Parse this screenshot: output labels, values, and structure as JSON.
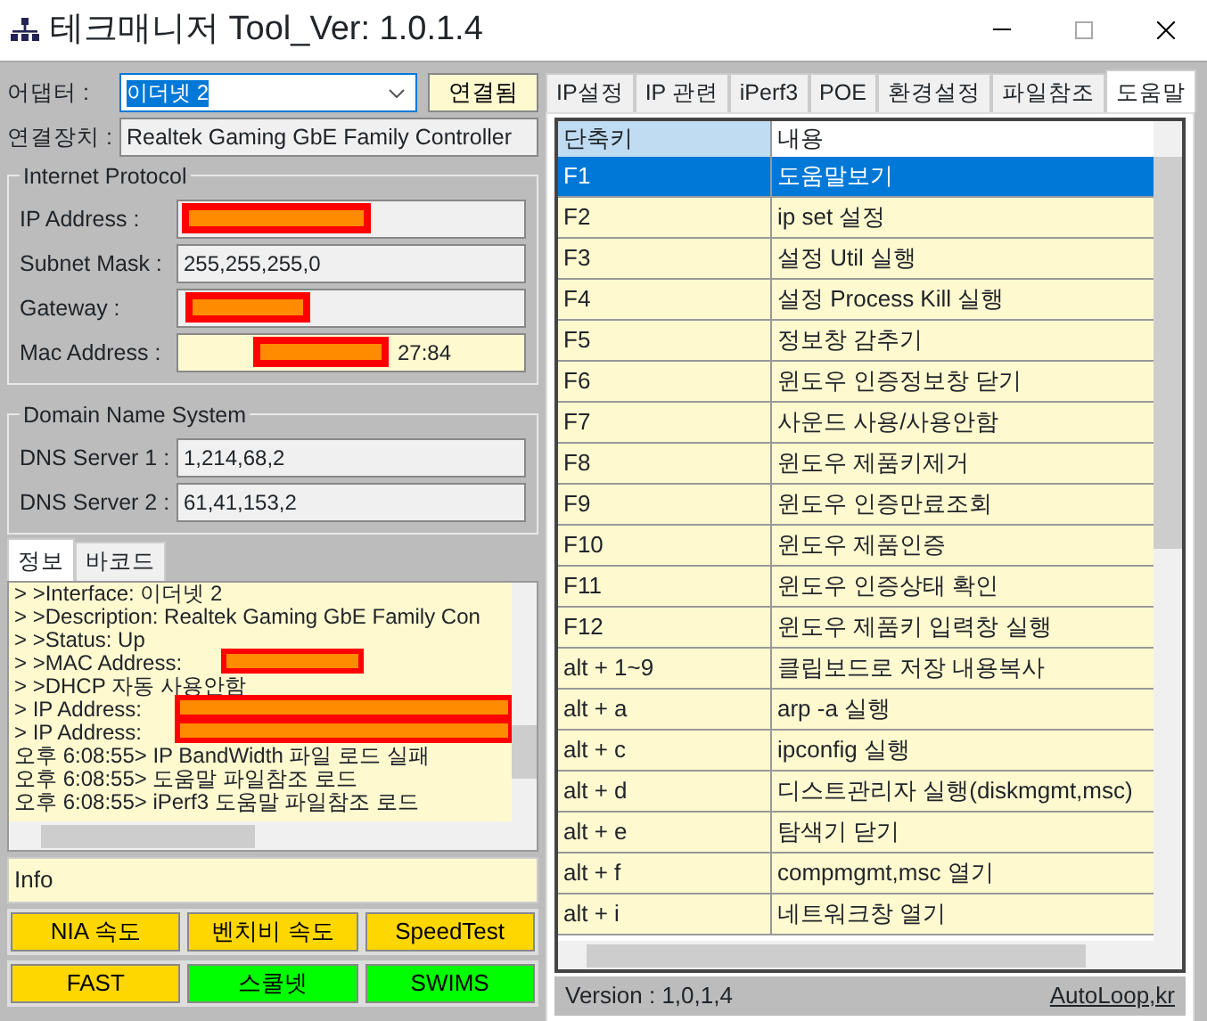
{
  "window": {
    "title": "테크매니저 Tool_Ver: 1.0.1.4"
  },
  "adapter": {
    "label": "어댑터 :",
    "value": "이더넷 2",
    "status_button": "연결됨"
  },
  "device": {
    "label": "연결장치 :",
    "value": "Realtek Gaming GbE Family Controller"
  },
  "internet_protocol": {
    "title": "Internet Protocol",
    "fields": [
      {
        "label": "IP Address :",
        "redacted": true
      },
      {
        "label": "Subnet Mask :",
        "value": "255,255,255,0"
      },
      {
        "label": "Gateway :",
        "redacted": true
      },
      {
        "label": "Mac Address :",
        "value": "27:84",
        "redacted": true
      }
    ]
  },
  "dns": {
    "title": "Domain Name System",
    "fields": [
      {
        "label": "DNS Server 1 :",
        "value": "1,214,68,2"
      },
      {
        "label": "DNS Server 2 :",
        "value": "61,41,153,2"
      }
    ]
  },
  "left_tabs": [
    {
      "label": "정보",
      "selected": true
    },
    {
      "label": "바코드",
      "selected": false
    }
  ],
  "log": [
    {
      "text": "> >Interface: 이더넷 2"
    },
    {
      "text": "> >Description: Realtek Gaming GbE Family Con"
    },
    {
      "text": "> >Status: Up"
    },
    {
      "text": "> >MAC Address:",
      "redacted": true
    },
    {
      "text": "> >DHCP 자동 사용안함"
    },
    {
      "text": "> IP Address:",
      "redacted": true
    },
    {
      "text": "> IP Address:",
      "redacted": true
    },
    {
      "text": "오후 6:08:55> IP BandWidth 파일 로드 실패"
    },
    {
      "text": "오후 6:08:55> 도움말 파일참조 로드"
    },
    {
      "text": "오후 6:08:55> iPerf3 도움말 파일참조 로드"
    }
  ],
  "info": "Info",
  "buttons": [
    {
      "label": "NIA 속도",
      "color": "#ffd700"
    },
    {
      "label": "벤치비 속도",
      "color": "#ffd700"
    },
    {
      "label": "SpeedTest",
      "color": "#ffd700"
    },
    {
      "label": "FAST",
      "color": "#ffd700"
    },
    {
      "label": "스쿨넷",
      "color": "#00ff00"
    },
    {
      "label": "SWIMS",
      "color": "#00ff00"
    }
  ],
  "right_tabs": [
    {
      "label": "IP설정",
      "selected": false
    },
    {
      "label": "IP 관련",
      "selected": false
    },
    {
      "label": "iPerf3",
      "selected": false
    },
    {
      "label": "POE",
      "selected": false
    },
    {
      "label": "환경설정",
      "selected": false
    },
    {
      "label": "파일참조",
      "selected": false
    },
    {
      "label": "도움말",
      "selected": true
    }
  ],
  "table": {
    "columns": [
      "단축키",
      "내용"
    ],
    "rows": [
      {
        "key": "F1",
        "desc": "도움말보기",
        "selected": true
      },
      {
        "key": "F2",
        "desc": "ip set 설정",
        "selected": false
      },
      {
        "key": "F3",
        "desc": "설정 Util 실행",
        "selected": false
      },
      {
        "key": "F4",
        "desc": "설정 Process Kill 실행",
        "selected": false
      },
      {
        "key": "F5",
        "desc": "정보창 감추기",
        "selected": false
      },
      {
        "key": "F6",
        "desc": "윈도우 인증정보창 닫기",
        "selected": false
      },
      {
        "key": "F7",
        "desc": "사운드 사용/사용안함",
        "selected": false
      },
      {
        "key": "F8",
        "desc": "윈도우 제품키제거",
        "selected": false
      },
      {
        "key": "F9",
        "desc": "윈도우 인증만료조회",
        "selected": false
      },
      {
        "key": "F10",
        "desc": "윈도우 제품인증",
        "selected": false
      },
      {
        "key": "F11",
        "desc": "윈도우 인증상태 확인",
        "selected": false
      },
      {
        "key": "F12",
        "desc": "윈도우 제품키 입력창 실행",
        "selected": false
      },
      {
        "key": "alt + 1~9",
        "desc": "클립보드로 저장 내용복사",
        "selected": false
      },
      {
        "key": "alt + a",
        "desc": "arp -a 실행",
        "selected": false
      },
      {
        "key": "alt + c",
        "desc": "ipconfig 실행",
        "selected": false
      },
      {
        "key": "alt + d",
        "desc": "디스트관리자 실행(diskmgmt,msc)",
        "selected": false
      },
      {
        "key": "alt + e",
        "desc": "탐색기 닫기",
        "selected": false
      },
      {
        "key": "alt + f",
        "desc": "compmgmt,msc 열기",
        "selected": false
      },
      {
        "key": "alt + i",
        "desc": "네트워크창 열기",
        "selected": false
      }
    ]
  },
  "status": {
    "version": "Version : 1,0,1,4",
    "link": "AutoLoop,kr"
  }
}
